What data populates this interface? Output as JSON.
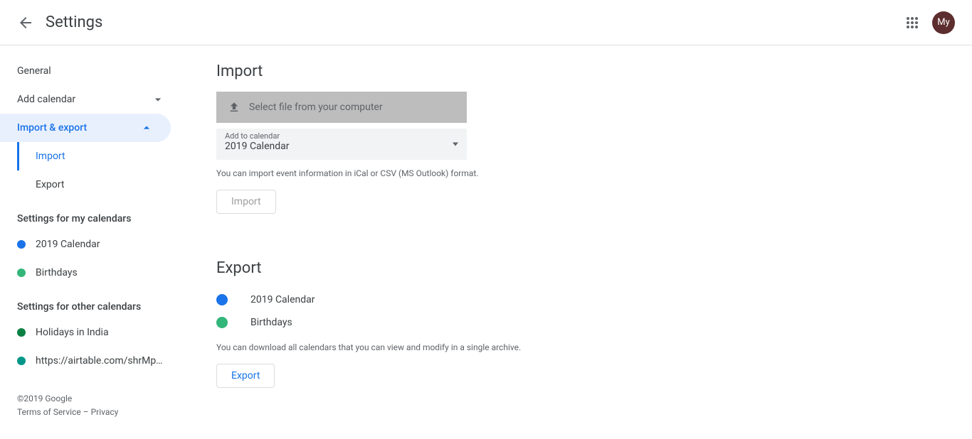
{
  "header": {
    "title": "Settings",
    "avatar_text": "My"
  },
  "sidebar": {
    "general": "General",
    "add_calendar": "Add calendar",
    "import_export": "Import & export",
    "import": "Import",
    "export": "Export",
    "my_calendars_head": "Settings for my calendars",
    "my_calendars": [
      {
        "label": "2019 Calendar",
        "color": "#1a73e8"
      },
      {
        "label": "Birthdays",
        "color": "#33b679"
      }
    ],
    "other_calendars_head": "Settings for other calendars",
    "other_calendars": [
      {
        "label": "Holidays in India",
        "color": "#0b8043"
      },
      {
        "label": "https://airtable.com/shrMp…",
        "color": "#009688"
      }
    ]
  },
  "footer": {
    "copyright": "©2019 Google",
    "terms": "Terms of Service",
    "sep": " – ",
    "privacy": "Privacy"
  },
  "import": {
    "heading": "Import",
    "select_file": "Select file from your computer",
    "add_to_label": "Add to calendar",
    "add_to_value": "2019 Calendar",
    "help": "You can import event information in iCal or CSV (MS Outlook) format.",
    "button": "Import"
  },
  "export": {
    "heading": "Export",
    "calendars": [
      {
        "label": "2019 Calendar",
        "color": "#1a73e8"
      },
      {
        "label": "Birthdays",
        "color": "#33b679"
      }
    ],
    "help": "You can download all calendars that you can view and modify in a single archive.",
    "button": "Export"
  }
}
